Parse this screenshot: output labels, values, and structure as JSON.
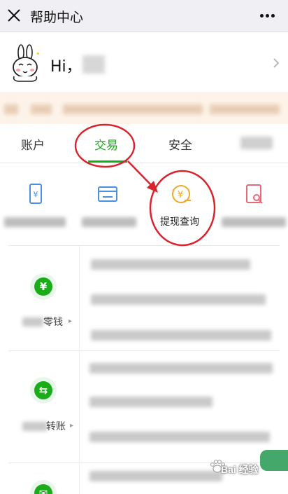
{
  "header": {
    "title": "帮助中心",
    "close_icon": "close-icon",
    "more_icon": "more-dots-icon"
  },
  "profile": {
    "greeting": "Hi，",
    "avatar_icon": "rabbit-avatar-icon"
  },
  "tabs": [
    {
      "label": "账户",
      "active": false
    },
    {
      "label": "交易",
      "active": true
    },
    {
      "label": "安全",
      "active": false
    },
    {
      "label": "",
      "active": false
    }
  ],
  "grid": [
    {
      "label": "",
      "icon": "phone-yen-icon",
      "color": "#4a90e2"
    },
    {
      "label": "",
      "icon": "card-transfer-icon",
      "color": "#4a90e2"
    },
    {
      "label": "提现查询",
      "icon": "withdraw-yen-icon",
      "color": "#f0a830"
    },
    {
      "label": "",
      "icon": "receipt-search-icon",
      "color": "#e66a7a"
    }
  ],
  "categories": [
    {
      "label": "零钱",
      "icon": "yen-icon",
      "symbol": "¥"
    },
    {
      "label": "转账",
      "icon": "transfer-arrows-icon",
      "symbol": "⇆"
    },
    {
      "label": "",
      "icon": "envelope-icon",
      "symbol": "✉"
    }
  ],
  "watermark": {
    "text": "Bai  经验",
    "color": "#2f9e5a"
  },
  "colors": {
    "accent": "#1aad19",
    "annotation": "#d9232d",
    "notice_bg": "#fdf3e8",
    "header_bg": "#efeff4"
  }
}
